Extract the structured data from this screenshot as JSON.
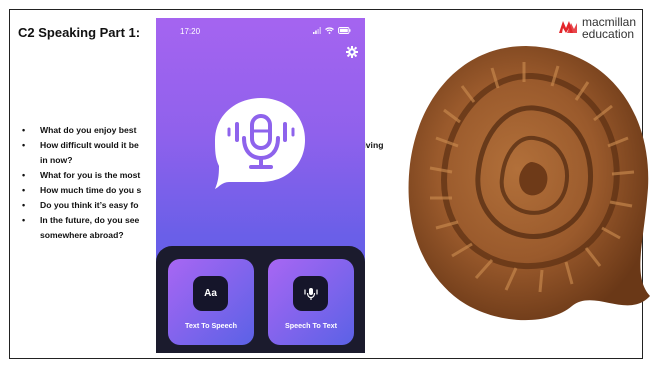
{
  "slide": {
    "title": "C2 Speaking Part 1:",
    "questions": [
      {
        "line1": "What do you enjoy best",
        "line2": ""
      },
      {
        "line1": "How difficult would it be",
        "line2": "in now?"
      },
      {
        "line1": "What for you is the most",
        "line2": ""
      },
      {
        "line1": "How much time do you s",
        "line2": ""
      },
      {
        "line1": "Do you think it’s easy fo",
        "line2": ""
      },
      {
        "line1": "In the future, do you see",
        "line2": "somewhere abroad?"
      }
    ],
    "partial_word": "living"
  },
  "logo": {
    "line1": "macmillan",
    "line2": "education",
    "color": "#e3262b"
  },
  "app": {
    "status_time": "17:20",
    "gradient_top": "#a564f0",
    "gradient_bottom": "#5a61e6",
    "cards": [
      {
        "icon_text": "Aa",
        "label": "Text To Speech",
        "icon": "text-aa-icon"
      },
      {
        "icon_text": "",
        "label": "Speech To Text",
        "icon": "mic-waves-icon"
      }
    ]
  }
}
